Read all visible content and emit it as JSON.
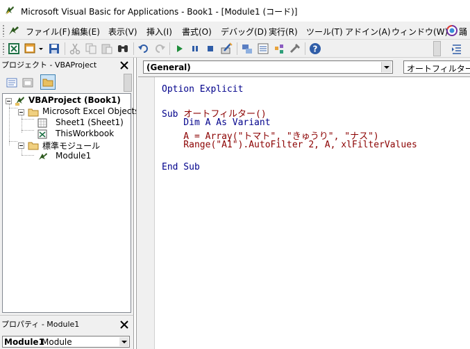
{
  "titlebar": {
    "title": "Microsoft Visual Basic for Applications - Book1 - [Module1 (コード)]"
  },
  "menu": {
    "items": [
      "ファイル(F)",
      "編集(E)",
      "表示(V)",
      "挿入(I)",
      "書式(O)",
      "デバッグ(D)",
      "実行(R)",
      "ツール(T)",
      "アドイン(A)",
      "ウィンドウ(W)"
    ],
    "help_partial": "踊"
  },
  "toolbar": {
    "buttons": [
      "view-excel-icon",
      "insert-userform-icon",
      "save-icon",
      "cut-icon",
      "copy-icon",
      "paste-icon",
      "find-icon",
      "undo-icon",
      "redo-icon",
      "run-icon",
      "break-icon",
      "reset-icon",
      "design-mode-icon",
      "project-explorer-icon",
      "properties-icon",
      "object-browser-icon",
      "toolbox-icon",
      "help-icon"
    ]
  },
  "project_explorer": {
    "title": "プロジェクト - VBAProject",
    "tree": {
      "root": "VBAProject (Book1)",
      "folder1": "Microsoft Excel Objects",
      "sheet1": "Sheet1 (Sheet1)",
      "workbook": "ThisWorkbook",
      "folder2": "標準モジュール",
      "module1": "Module1"
    }
  },
  "properties": {
    "title": "プロパティ - Module1",
    "object_name": "Module1",
    "object_type": "Module"
  },
  "code_window": {
    "object_combo": "(General)",
    "procedure_combo": "オートフィルター",
    "code": {
      "l1": "Option Explicit",
      "l2_kw": "Sub ",
      "l2_name": "オートフィルター()",
      "l3": "    Dim A As Variant",
      "l4_a": "    A = Array(\"",
      "l4_b": "トマト",
      "l4_c": "\", \"",
      "l4_d": "きゅうり",
      "l4_e": "\", \"",
      "l4_f": "ナス",
      "l4_g": "\")",
      "l5": "    Range(\"A1\").AutoFilter 2, A, xlFilterValues",
      "l6": "End Sub"
    }
  },
  "colors": {
    "code_keyword": "#00008b",
    "code_japanese": "#8b0000",
    "chrome": "#f0f0f0"
  }
}
